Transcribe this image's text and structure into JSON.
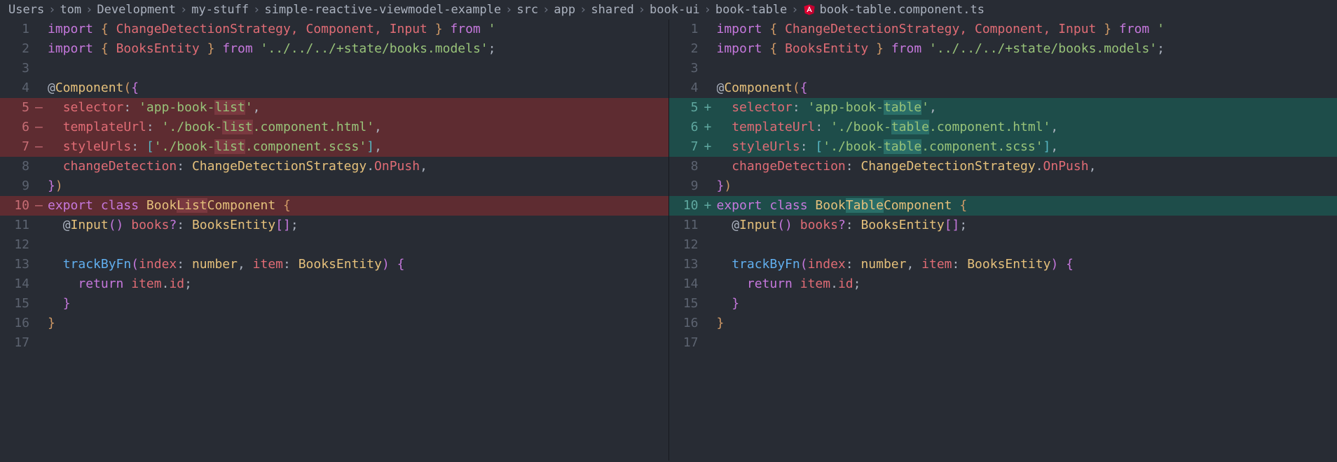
{
  "breadcrumb": {
    "items": [
      "Users",
      "tom",
      "Development",
      "my-stuff",
      "simple-reactive-viewmodel-example",
      "src",
      "app",
      "shared",
      "book-ui",
      "book-table"
    ],
    "file": "book-table.component.ts",
    "separator": "›"
  },
  "left": {
    "lines": [
      {
        "num": "1",
        "marker": "",
        "type": "normal"
      },
      {
        "num": "2",
        "marker": "",
        "type": "normal"
      },
      {
        "num": "3",
        "marker": "",
        "type": "normal"
      },
      {
        "num": "4",
        "marker": "",
        "type": "normal"
      },
      {
        "num": "5",
        "marker": "—",
        "type": "deleted"
      },
      {
        "num": "6",
        "marker": "—",
        "type": "deleted"
      },
      {
        "num": "7",
        "marker": "—",
        "type": "deleted"
      },
      {
        "num": "8",
        "marker": "",
        "type": "normal"
      },
      {
        "num": "9",
        "marker": "",
        "type": "normal"
      },
      {
        "num": "10",
        "marker": "—",
        "type": "deleted"
      },
      {
        "num": "11",
        "marker": "",
        "type": "normal"
      },
      {
        "num": "12",
        "marker": "",
        "type": "normal"
      },
      {
        "num": "13",
        "marker": "",
        "type": "normal"
      },
      {
        "num": "14",
        "marker": "",
        "type": "normal"
      },
      {
        "num": "15",
        "marker": "",
        "type": "normal"
      },
      {
        "num": "16",
        "marker": "",
        "type": "normal"
      },
      {
        "num": "17",
        "marker": "",
        "type": "normal"
      }
    ],
    "code": {
      "selector": "'app-book-list'",
      "templateUrl": "'./book-list.component.html'",
      "styleUrls": "'./book-list.component.scss'",
      "className": "BookListComponent"
    }
  },
  "right": {
    "lines": [
      {
        "num": "1",
        "marker": "",
        "type": "normal"
      },
      {
        "num": "2",
        "marker": "",
        "type": "normal"
      },
      {
        "num": "3",
        "marker": "",
        "type": "normal"
      },
      {
        "num": "4",
        "marker": "",
        "type": "normal"
      },
      {
        "num": "5",
        "marker": "+",
        "type": "added"
      },
      {
        "num": "6",
        "marker": "+",
        "type": "added"
      },
      {
        "num": "7",
        "marker": "+",
        "type": "added"
      },
      {
        "num": "8",
        "marker": "",
        "type": "normal"
      },
      {
        "num": "9",
        "marker": "",
        "type": "normal"
      },
      {
        "num": "10",
        "marker": "+",
        "type": "added"
      },
      {
        "num": "11",
        "marker": "",
        "type": "normal"
      },
      {
        "num": "12",
        "marker": "",
        "type": "normal"
      },
      {
        "num": "13",
        "marker": "",
        "type": "normal"
      },
      {
        "num": "14",
        "marker": "",
        "type": "normal"
      },
      {
        "num": "15",
        "marker": "",
        "type": "normal"
      },
      {
        "num": "16",
        "marker": "",
        "type": "normal"
      },
      {
        "num": "17",
        "marker": "",
        "type": "normal"
      }
    ],
    "code": {
      "selector": "'app-book-table'",
      "templateUrl": "'./book-table.component.html'",
      "styleUrls": "'./book-table.component.scss'",
      "className": "BookTableComponent"
    }
  },
  "common": {
    "import1_names": "ChangeDetectionStrategy, Component, Input",
    "import1_from": "from",
    "import2_name": "BooksEntity",
    "import2_path": "'../../../+state/books.models'",
    "decorator": "@Component",
    "selector_key": "selector",
    "templateUrl_key": "templateUrl",
    "styleUrls_key": "styleUrls",
    "changeDetection_key": "changeDetection",
    "changeDetection_val": "ChangeDetectionStrategy",
    "changeDetection_prop": "OnPush",
    "export": "export",
    "class": "class",
    "input_decorator": "@Input",
    "books_prop": "books",
    "books_type": "BooksEntity",
    "trackByFn": "trackByFn",
    "index_param": "index",
    "number_type": "number",
    "item_param": "item",
    "return": "return",
    "item_ref": "item",
    "id_prop": "id"
  }
}
